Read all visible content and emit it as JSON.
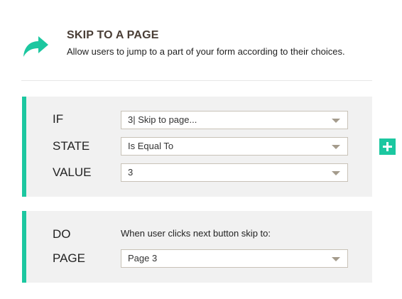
{
  "header": {
    "icon": "forward-arrow-icon",
    "title": "SKIP TO A PAGE",
    "description": "Allow users to jump to a part of your form according to their choices."
  },
  "condition": {
    "if_label": "IF",
    "if_value": "3| Skip to page...",
    "state_label": "STATE",
    "state_value": "Is Equal To",
    "value_label": "VALUE",
    "value_value": "3"
  },
  "action": {
    "do_label": "DO",
    "do_text": "When user clicks next button skip to:",
    "page_label": "PAGE",
    "page_value": "Page 3"
  },
  "colors": {
    "accent": "#1cc7a0",
    "title": "#4a3e36",
    "panel_bg": "#f1f1f1"
  },
  "add_button_icon": "plus-icon"
}
